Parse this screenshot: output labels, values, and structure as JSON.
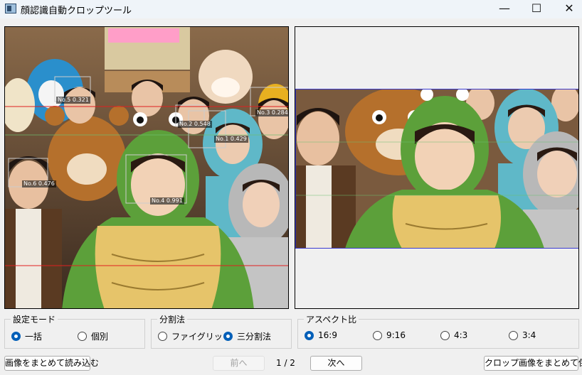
{
  "window": {
    "title": "顔認識自動クロップツール",
    "minimize_glyph": "—",
    "maximize_glyph": "☐",
    "close_glyph": "✕"
  },
  "left_panel": {
    "face_labels": [
      {
        "id": "face-1",
        "text": "No.1 0.429"
      },
      {
        "id": "face-2",
        "text": "No.2 0.548"
      },
      {
        "id": "face-3",
        "text": "No.3 0.284"
      },
      {
        "id": "face-4",
        "text": "No.4 0.991"
      },
      {
        "id": "face-5",
        "text": "No.5 0.321"
      },
      {
        "id": "face-6",
        "text": "No.6 0.476"
      }
    ]
  },
  "settings_mode": {
    "legend": "設定モード",
    "options": [
      {
        "label": "一括",
        "checked": true
      },
      {
        "label": "個別",
        "checked": false
      }
    ]
  },
  "division": {
    "legend": "分割法",
    "options": [
      {
        "label": "ファイグリッド",
        "checked": false
      },
      {
        "label": "三分割法",
        "checked": true
      }
    ]
  },
  "aspect": {
    "legend": "アスペクト比",
    "options": [
      {
        "label": "16:9",
        "checked": true
      },
      {
        "label": "9:16",
        "checked": false
      },
      {
        "label": "4:3",
        "checked": false
      },
      {
        "label": "3:4",
        "checked": false
      }
    ]
  },
  "footer": {
    "load_button": "画像をまとめて読み込む",
    "prev_button": "前へ",
    "page_indicator": "1 / 2",
    "next_button": "次へ",
    "save_button": "クロップ画像をまとめて保存"
  },
  "colors": {
    "thirds_line": "#e02020",
    "face_box": "#cccccc",
    "crop_border": "#3a3ad0",
    "radio_accent": "#005fb8"
  }
}
